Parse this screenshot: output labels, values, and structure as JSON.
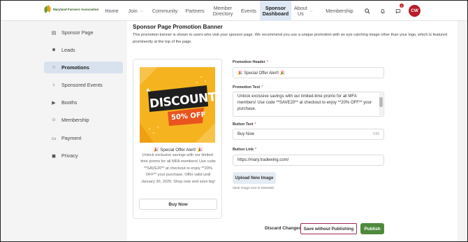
{
  "brand": {
    "name": "Maryland Farmers Association"
  },
  "nav": {
    "items": [
      {
        "label": "Home"
      },
      {
        "label": "Join",
        "has_menu": true
      },
      {
        "label": "Community"
      },
      {
        "label": "Partners"
      },
      {
        "label": "Member\nDirectory"
      },
      {
        "label": "Events"
      },
      {
        "label": "Sponsor\nDashboard",
        "active": true
      },
      {
        "label": "About\nUs",
        "has_menu": true
      },
      {
        "label": "Membership"
      }
    ],
    "icons": [
      "search-icon",
      "bell-icon",
      "chat-icon"
    ],
    "notification_count": "1",
    "avatar_initials": "CW"
  },
  "sidebar": {
    "items": [
      {
        "label": "Sponsor Page",
        "icon": "layout-icon"
      },
      {
        "label": "Leads",
        "icon": "users-icon"
      },
      {
        "label": "Promotions",
        "icon": "tag-icon",
        "active": true
      },
      {
        "label": "Sponsored Events",
        "icon": "microphone-icon"
      },
      {
        "label": "Booths",
        "icon": "video-icon"
      },
      {
        "label": "Membership",
        "icon": "people-icon"
      },
      {
        "label": "Payment",
        "icon": "card-icon"
      },
      {
        "label": "Privacy",
        "icon": "lock-icon"
      }
    ]
  },
  "main": {
    "heading": "Sponsor Page Promotion Banner",
    "intro": "This promotion banner is shown to users who visit your sponsor page. We recommend you use a unique promotion with an eye catching image other than your logo, which is featured prominently at the top of the page.",
    "preview": {
      "image_text_1": "DISCOUNT",
      "image_text_2": "50% OFF",
      "title": "🎉 Special Offer Alert! 🎉",
      "body": "Unlock exclusive savings with our limited-time promo for all MFA members! Use code **SAVE20** at checkout to enjoy **20% OFF** your purchase. Offer valid until January 30, 2025. Shop now and save big!",
      "button": "Buy Now"
    },
    "form": {
      "header_label": "Promotion Header",
      "header_value": "🎉 Special Offer Alert! 🎉",
      "text_label": "Promotion Text",
      "text_value": "Unlock exclusive savings with our limited-time promo for all MFA members! Use code **SAVE20** at checkout to enjoy **20% OFF** your purchase.",
      "button_text_label": "Button Text",
      "button_text_value": "Buy Now",
      "button_text_counter": "7/25",
      "button_link_label": "Button Link",
      "button_link_value": "https://mary.tradewing.com/",
      "required_mark": "*",
      "upload_button": "Upload New Image",
      "upload_hint": "Ideal image size is 560x560"
    },
    "actions": {
      "discard": "Discard Changes",
      "save_without_publishing": "Save without Publishing",
      "publish": "Publish"
    }
  },
  "colors": {
    "accent_green": "#4f8a3c",
    "active_nav": "#dfe9f5",
    "highlight_border": "#a22658",
    "avatar": "#b71c2b",
    "promo_orange": "#f5b31f"
  }
}
